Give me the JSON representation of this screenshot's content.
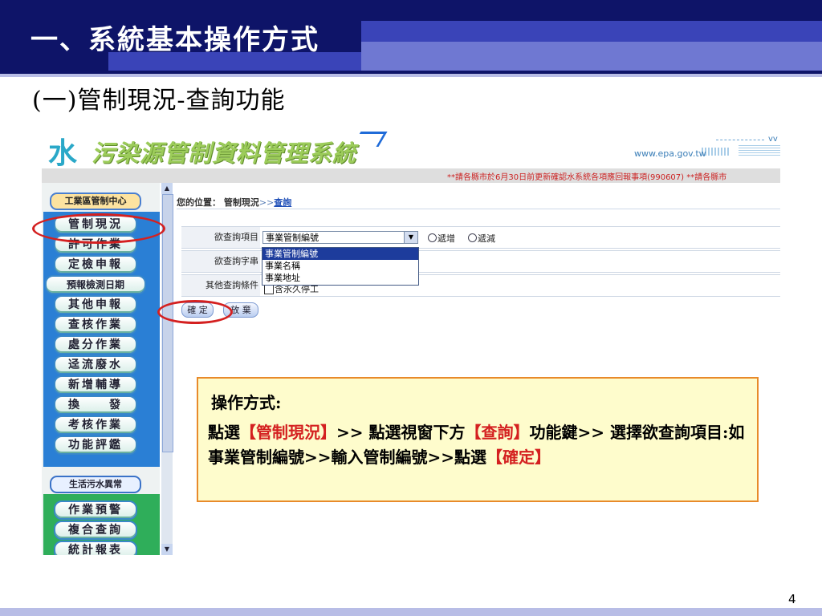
{
  "slide": {
    "title": "一、系統基本操作方式",
    "subtitle": "(一)管制現況-查詢功能",
    "page_number": "4"
  },
  "app": {
    "logo_mark": "水",
    "logo_text": "污染源管制資料管理系統",
    "site_url": "www.epa.gov.tw",
    "site_url_fragment": "vv",
    "notice": "**請各縣市於6月30日前更新確認水系統各項應回報事項(990607) **請各縣市"
  },
  "sidebar": {
    "center_label": "工業區管制中心",
    "items": [
      "管制現況",
      "許可作業",
      "定檢申報",
      "預報檢測日期",
      "其他申報",
      "查核作業",
      "處分作業",
      "迳流廢水",
      "新增輔導",
      "換　　發",
      "考核作業",
      "功能評鑑"
    ],
    "life_label": "生活污水異常",
    "items2": [
      "作業預警",
      "複合查詢",
      "統計報表"
    ]
  },
  "breadcrumb": {
    "prefix": "您的位置：",
    "section": "管制現況",
    "separator": ">>",
    "current": "查詢"
  },
  "form": {
    "query_item_label": "欲查詢項目",
    "query_item_value": "事業管制編號",
    "order_asc": "遞增",
    "order_desc": "遞減",
    "query_string_label": "欲查詢字串",
    "other_label": "其他查詢條件",
    "other_checkbox_text": "含永久停工",
    "dropdown_options": [
      "事業管制編號",
      "事業名稱",
      "事業地址"
    ],
    "ok_button": "確 定",
    "cancel_button": "放 棄"
  },
  "note": {
    "title": "操作方式:",
    "p1": "點選",
    "k1": "【管制現況】",
    "p2": ">> 點選視窗下方",
    "k2": "【查詢】",
    "p3": "功能鍵>> 選擇欲查詢項目:如事業管制編號>>輸入管制編號>>點選",
    "k3": "【確定】"
  },
  "colors": {
    "header_dark": "#0e1468",
    "highlight_red": "#d42020",
    "note_bg": "#fefccc",
    "note_border": "#e88a2a"
  }
}
